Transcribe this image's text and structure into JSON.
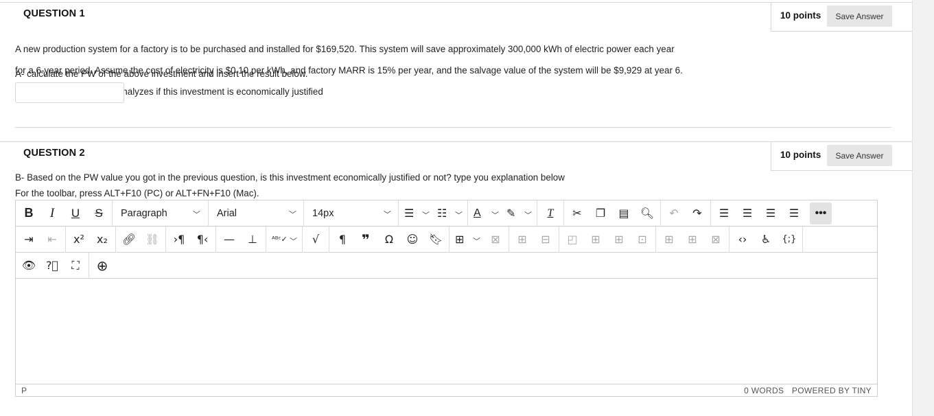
{
  "question1": {
    "title": "QUESTION 1",
    "points": "10 points",
    "save_label": "Save Answer",
    "line1": "A new production system for a factory is to be purchased and installed for $169,520. This system will save approximately 300,000 kWh of electric power each year",
    "line2": "for a 6-year period. Assume the cost of electricity is $0.10 per kWh, and factory MARR is 15% per year, and the salvage value of the system will be $9,929 at year 6.",
    "line3": "Using the PW method to analyzes if this investment is economically justified",
    "prompt": "A- calculate the PW of the above investment and insert the result below.",
    "answer_value": ""
  },
  "question2": {
    "title": "QUESTION 2",
    "points": "10 points",
    "save_label": "Save Answer",
    "text": "B- Based on the PW value you got in the previous question, is this investment economically  justified or not? type you explanation below",
    "toolbar_hint": "For the toolbar, press ALT+F10 (PC) or ALT+FN+F10 (Mac)."
  },
  "editor": {
    "block_format": "Paragraph",
    "font_family": "Arial",
    "font_size": "14px",
    "status_path": "P",
    "word_count": "0 WORDS",
    "powered_by": "POWERED BY TINY",
    "icons": {
      "row1": [
        "bold-icon",
        "italic-icon",
        "underline-icon",
        "strikethrough-icon",
        "bullet-list-icon",
        "numbered-list-icon",
        "text-color-icon",
        "highlight-color-icon",
        "clear-format-icon",
        "cut-icon",
        "copy-icon",
        "paste-icon",
        "find-icon",
        "undo-icon",
        "redo-icon",
        "align-left-icon",
        "align-center-icon",
        "align-right-icon",
        "justify-icon",
        "more-icon"
      ],
      "row2": [
        "indent-icon",
        "outdent-icon",
        "superscript-icon",
        "subscript-icon",
        "link-icon",
        "unlink-icon",
        "ltr-icon",
        "rtl-icon",
        "horizontal-rule-icon",
        "insert-anchor-icon",
        "spellcheck-icon",
        "math-icon",
        "paragraph-mark-icon",
        "blockquote-icon",
        "special-char-icon",
        "emoticon-icon",
        "bookmark-icon",
        "table-icon",
        "table-delete-icon",
        "insert-row-icon",
        "delete-row-icon",
        "merge-cells-icon",
        "insert-column-icon",
        "split-cell-icon",
        "cell-properties-icon",
        "row-properties-icon",
        "column-properties-icon",
        "delete-column-icon",
        "source-code-icon",
        "accessibility-icon",
        "embed-icon"
      ],
      "row3": [
        "preview-icon",
        "help-icon",
        "fullscreen-icon",
        "add-content-icon"
      ]
    }
  }
}
